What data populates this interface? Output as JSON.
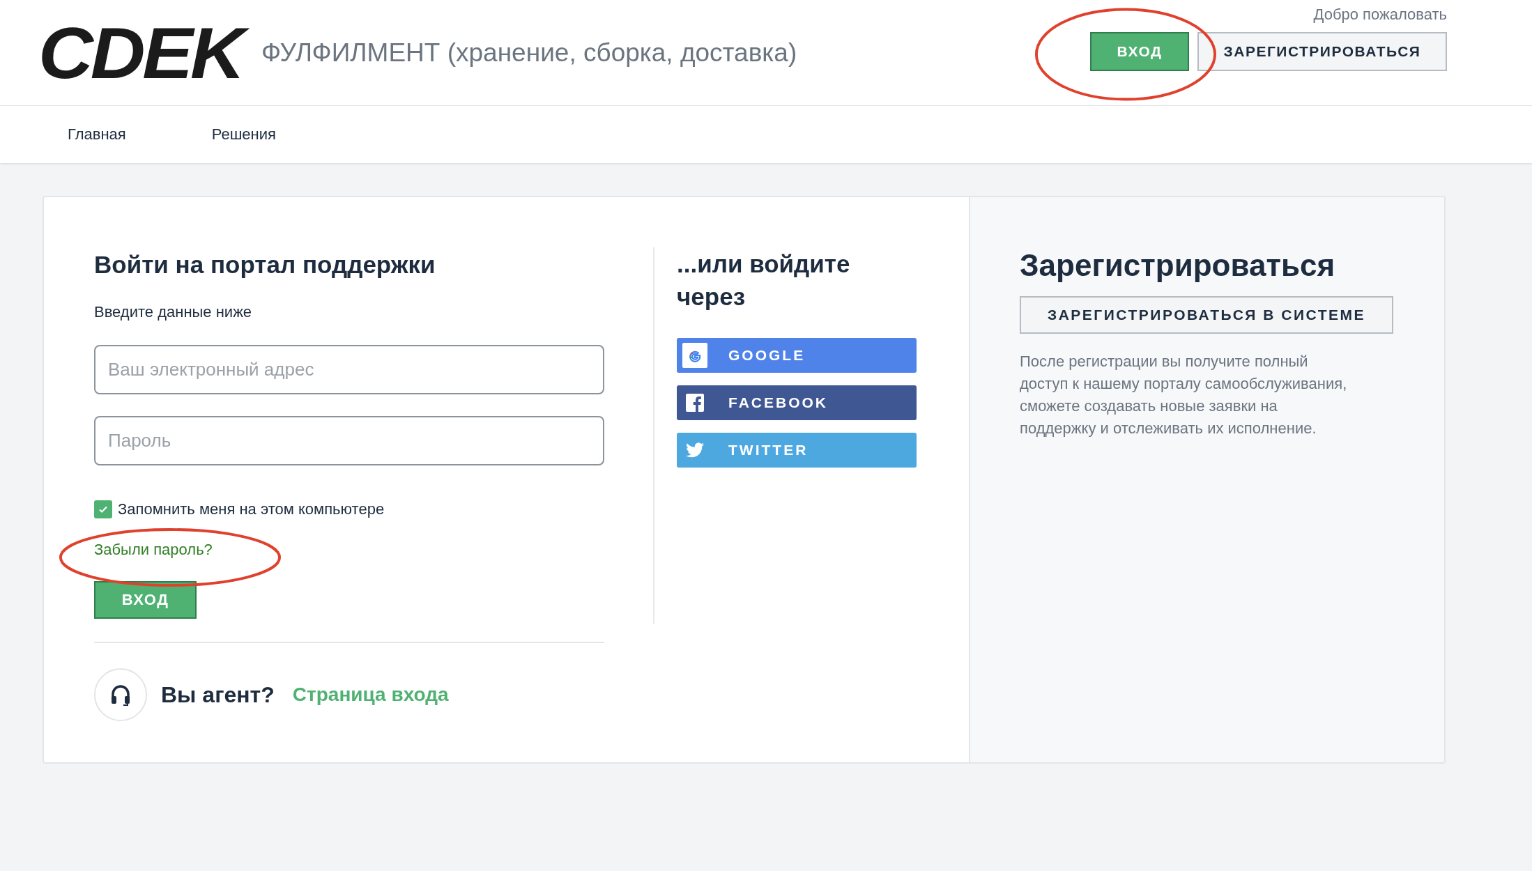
{
  "header": {
    "logo": "CDEK",
    "subtitle": "ФУЛФИЛМЕНТ (хранение, сборка, доставка)",
    "welcome": "Добро пожаловать",
    "login_button": "ВХОД",
    "register_button": "ЗАРЕГИСТРИРОВАТЬСЯ"
  },
  "nav": [
    {
      "label": "Главная"
    },
    {
      "label": "Решения"
    }
  ],
  "login": {
    "title": "Войти на портал поддержки",
    "subtitle": "Введите данные ниже",
    "email": {
      "placeholder": "Ваш электронный адрес"
    },
    "password": {
      "placeholder": "Пароль"
    },
    "remember": {
      "label": "Запомнить меня на этом компьютере",
      "checked": true
    },
    "forgot": "Забыли пароль?",
    "submit": "ВХОД",
    "agent_question": "Вы агент?",
    "agent_link": "Страница входа"
  },
  "social": {
    "title": "...или войдите через",
    "buttons": [
      {
        "kind": "google",
        "label": "GOOGLE",
        "color": "#5083ea"
      },
      {
        "kind": "facebook",
        "label": "FACEBOOK",
        "color": "#3f5893"
      },
      {
        "kind": "twitter",
        "label": "TWITTER",
        "color": "#4ea8e0"
      }
    ]
  },
  "register": {
    "title": "Зарегистрироваться",
    "button": "ЗАРЕГИСТРИРОВАТЬСЯ В СИСТЕМЕ",
    "description": "После регистрации вы получите полный доступ к нашему порталу самообслуживания, сможете создавать новые заявки на поддержку и отслеживать их исполнение."
  }
}
